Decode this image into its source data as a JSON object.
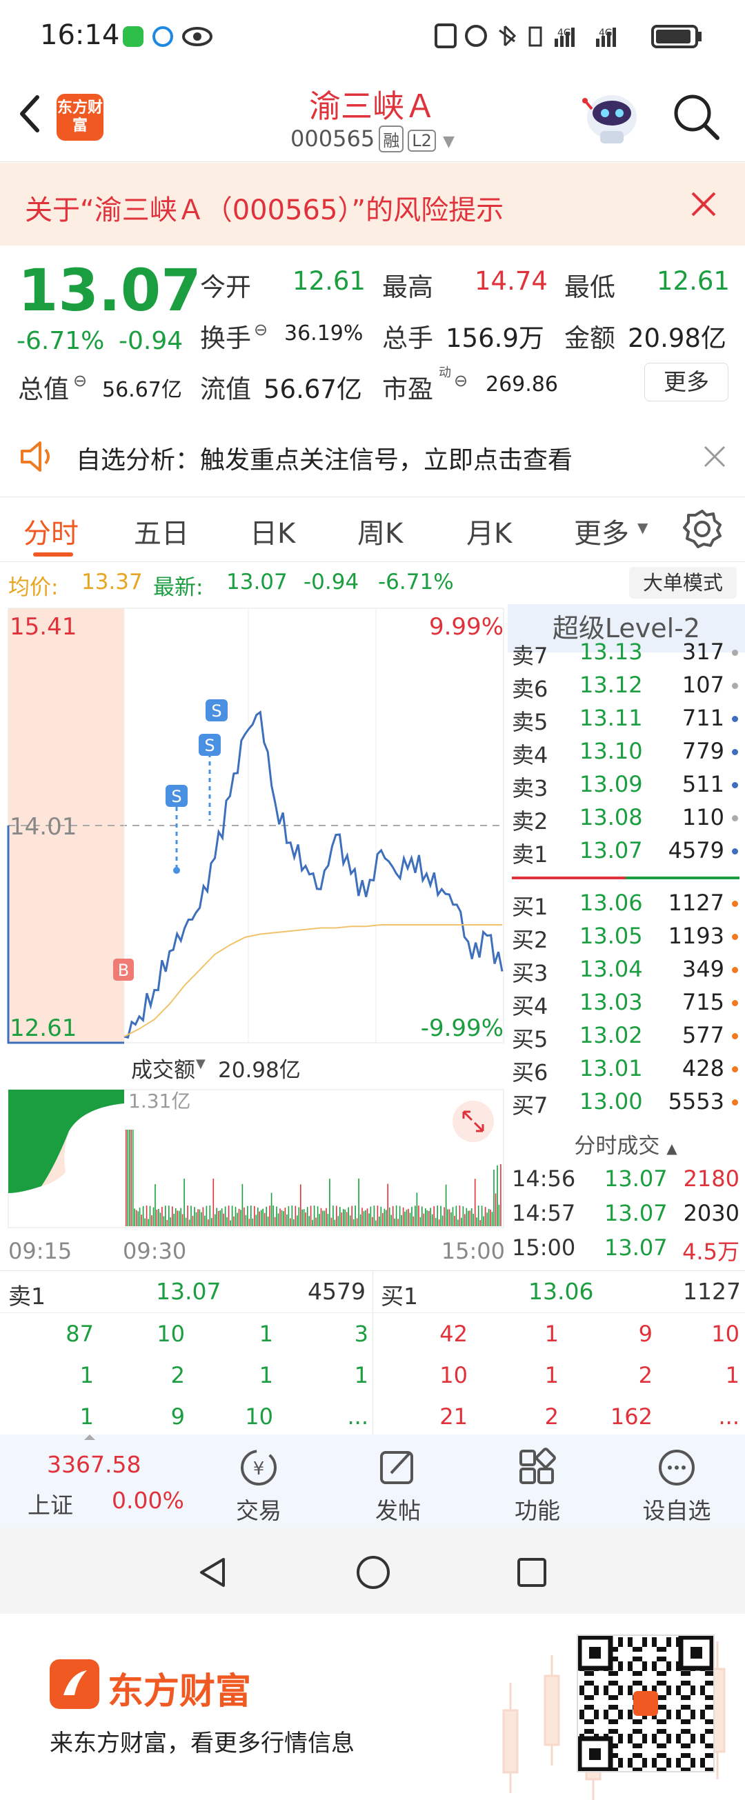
{
  "status": {
    "time": "16:14"
  },
  "header": {
    "stock_name": "渝三峡Ａ",
    "stock_code": "000565",
    "tag_margin": "融",
    "tag_level": "L2"
  },
  "brand": {
    "logo_text": "东方财富"
  },
  "risk": {
    "text": "关于“渝三峡Ａ（000565）”的风险提示"
  },
  "quote": {
    "price": "13.07",
    "change_pct": "-6.71%",
    "change": "-0.94",
    "open_label": "今开",
    "open": "12.61",
    "high_label": "最高",
    "high": "14.74",
    "low_label": "最低",
    "low": "12.61",
    "turnover_label": "换手",
    "turnover": "36.19%",
    "volume_label": "总手",
    "volume": "156.9万",
    "amount_label": "金额",
    "amount": "20.98亿",
    "mktcap_label": "总值",
    "mktcap": "56.67亿",
    "float_label": "流值",
    "float": "56.67亿",
    "pe_label": "市盈",
    "pe_sup": "动",
    "pe": "269.86",
    "more_label": "更多"
  },
  "notice": {
    "text": "自选分析：触发重点关注信号，立即点击查看"
  },
  "tabs": [
    {
      "label": "分时"
    },
    {
      "label": "五日"
    },
    {
      "label": "日K"
    },
    {
      "label": "周K"
    },
    {
      "label": "月K"
    },
    {
      "label": "更多"
    }
  ],
  "infobar": {
    "avg_label": "均价:",
    "avg": "13.37",
    "latest_label": "最新:",
    "latest": "13.07",
    "chg": "-0.94",
    "pct": "-6.71%",
    "mode": "大单模式"
  },
  "chart": {
    "y_top": "15.41",
    "y_mid": "14.01",
    "y_bot": "12.61",
    "pct_top": "9.99%",
    "pct_bot": "-9.99%",
    "vol_label": "成交额",
    "vol_total": "20.98亿",
    "vol_max": "1.31亿",
    "t_start": "09:15",
    "t_open": "09:30",
    "t_end": "15:00",
    "buy_marker": "B",
    "sell_marker": "S"
  },
  "chart_data": {
    "type": "line",
    "title": "",
    "x": [
      "09:30",
      "09:35",
      "09:40",
      "09:45",
      "09:50",
      "09:55",
      "10:00",
      "10:05",
      "10:10",
      "10:15",
      "10:20",
      "10:30",
      "10:45",
      "11:00",
      "11:15",
      "11:30",
      "13:15",
      "13:30",
      "13:45",
      "14:00",
      "14:15",
      "14:30",
      "14:45",
      "14:50",
      "14:55",
      "15:00"
    ],
    "series": [
      {
        "values": [
          12.65,
          12.78,
          12.95,
          13.2,
          13.35,
          13.48,
          13.8,
          14.2,
          14.6,
          14.74,
          14.15,
          13.9,
          13.75,
          13.6,
          13.95,
          13.7,
          13.55,
          13.85,
          13.7,
          13.8,
          13.7,
          13.6,
          13.5,
          13.15,
          13.3,
          13.07
        ]
      },
      {
        "values": [
          12.65,
          12.7,
          12.76,
          12.86,
          12.98,
          13.08,
          13.18,
          13.24,
          13.29,
          13.31,
          13.32,
          13.33,
          13.34,
          13.35,
          13.35,
          13.36,
          13.36,
          13.37,
          13.37,
          13.37,
          13.37,
          13.37,
          13.37,
          13.37,
          13.37,
          13.37
        ]
      }
    ],
    "xlabel": "",
    "ylabel": "",
    "ylim": [
      12.61,
      15.41
    ]
  },
  "book": {
    "header": "超级Level-2",
    "asks": [
      {
        "name": "卖7",
        "price": "13.13",
        "vol": "317"
      },
      {
        "name": "卖6",
        "price": "13.12",
        "vol": "107"
      },
      {
        "name": "卖5",
        "price": "13.11",
        "vol": "711"
      },
      {
        "name": "卖4",
        "price": "13.10",
        "vol": "779"
      },
      {
        "name": "卖3",
        "price": "13.09",
        "vol": "511"
      },
      {
        "name": "卖2",
        "price": "13.08",
        "vol": "110"
      },
      {
        "name": "卖1",
        "price": "13.07",
        "vol": "4579"
      }
    ],
    "bids": [
      {
        "name": "买1",
        "price": "13.06",
        "vol": "1127"
      },
      {
        "name": "买2",
        "price": "13.05",
        "vol": "1193"
      },
      {
        "name": "买3",
        "price": "13.04",
        "vol": "349"
      },
      {
        "name": "买4",
        "price": "13.03",
        "vol": "715"
      },
      {
        "name": "买5",
        "price": "13.02",
        "vol": "577"
      },
      {
        "name": "买6",
        "price": "13.01",
        "vol": "428"
      },
      {
        "name": "买7",
        "price": "13.00",
        "vol": "5553"
      }
    ],
    "trades_header": "分时成交",
    "trades": [
      {
        "time": "14:56",
        "price": "13.07",
        "vol": "2180"
      },
      {
        "time": "14:57",
        "price": "13.07",
        "vol": "2030"
      },
      {
        "time": "15:00",
        "price": "13.07",
        "vol": "4.5万"
      }
    ]
  },
  "queue": {
    "ask_label": "卖1",
    "ask_price": "13.07",
    "ask_vol": "4579",
    "bid_label": "买1",
    "bid_price": "13.06",
    "bid_vol": "1127",
    "ask_rows": [
      [
        "87",
        "10",
        "1",
        "3"
      ],
      [
        "1",
        "2",
        "1",
        "1"
      ],
      [
        "1",
        "9",
        "10",
        "..."
      ]
    ],
    "bid_rows": [
      [
        "42",
        "1",
        "9",
        "10"
      ],
      [
        "10",
        "1",
        "2",
        "1"
      ],
      [
        "21",
        "2",
        "162",
        "..."
      ]
    ]
  },
  "bottomnav": {
    "index_value": "3367.58",
    "index_name": "上证",
    "index_pct": "0.00%",
    "items": [
      {
        "label": "交易"
      },
      {
        "label": "发帖"
      },
      {
        "label": "功能"
      },
      {
        "label": "设自选"
      }
    ]
  },
  "footer": {
    "brand": "东方财富",
    "slogan": "来东方财富，看更多行情信息"
  }
}
